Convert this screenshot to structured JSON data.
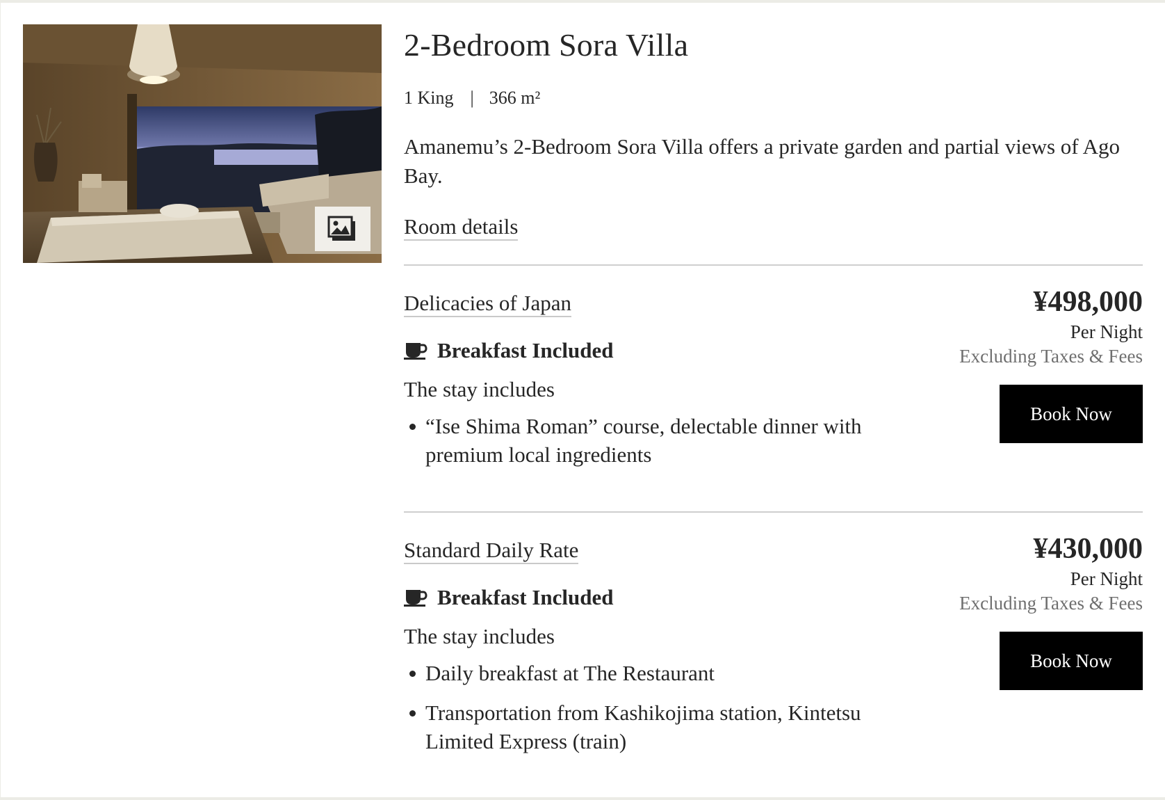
{
  "room": {
    "title": "2-Bedroom Sora Villa",
    "bed": "1 King",
    "separator": "|",
    "size": "366 m²",
    "description": "Amanemu’s 2-Bedroom Sora Villa offers a private garden and partial views of Ago Bay.",
    "details_link": "Room details"
  },
  "rates": [
    {
      "name": "Delicacies of Japan",
      "meal_icon": "coffee-cup-icon",
      "meal": "Breakfast Included",
      "includes_title": "The stay includes",
      "includes": [
        "“Ise Shima Roman” course, delectable dinner with premium local ingredients"
      ],
      "price": "¥498,000",
      "per_night": "Per Night",
      "tax_note": "Excluding Taxes & Fees",
      "button": "Book Now"
    },
    {
      "name": "Standard Daily Rate",
      "meal_icon": "coffee-cup-icon",
      "meal": "Breakfast Included",
      "includes_title": "The stay includes",
      "includes": [
        "Daily breakfast at The Restaurant",
        "Transportation from Kashikojima station, Kintetsu Limited Express (train)"
      ],
      "price": "¥430,000",
      "per_night": "Per Night",
      "tax_note": "Excluding Taxes & Fees",
      "button": "Book Now"
    }
  ],
  "colors": {
    "text": "#262626",
    "muted": "#6f6f6f",
    "button_bg": "#000000",
    "divider": "#cfcfcf"
  },
  "icons": {
    "gallery": "image-gallery-icon"
  }
}
